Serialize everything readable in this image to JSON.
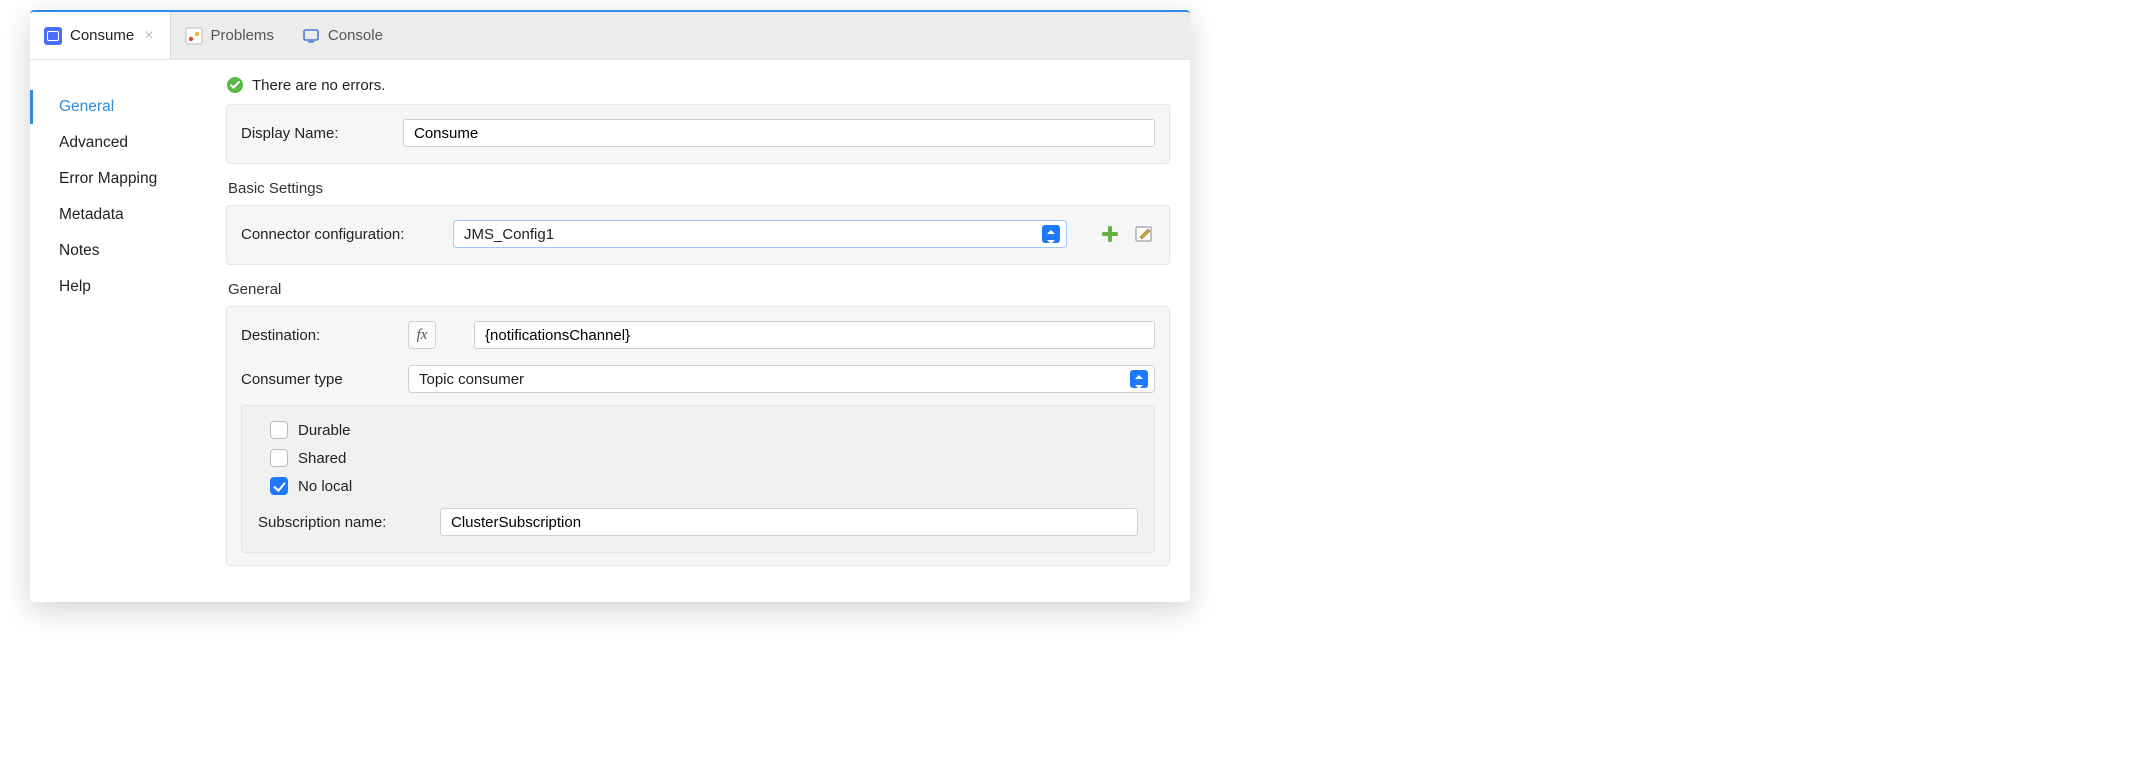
{
  "tabs": {
    "consume": {
      "label": "Consume"
    },
    "problems": {
      "label": "Problems"
    },
    "console": {
      "label": "Console"
    }
  },
  "sidebar": {
    "items": [
      {
        "label": "General"
      },
      {
        "label": "Advanced"
      },
      {
        "label": "Error Mapping"
      },
      {
        "label": "Metadata"
      },
      {
        "label": "Notes"
      },
      {
        "label": "Help"
      }
    ]
  },
  "status": {
    "message": "There are no errors."
  },
  "form": {
    "displayName": {
      "label": "Display Name:",
      "value": "Consume"
    },
    "basicSettings": {
      "title": "Basic Settings",
      "connectorConfig": {
        "label": "Connector configuration:",
        "value": "JMS_Config1"
      }
    },
    "general": {
      "title": "General",
      "destination": {
        "label": "Destination:",
        "value": "{notificationsChannel}"
      },
      "consumerType": {
        "label": "Consumer type",
        "value": "Topic consumer"
      },
      "fxLabel": "fx",
      "checkboxes": {
        "durable": {
          "label": "Durable",
          "checked": false
        },
        "shared": {
          "label": "Shared",
          "checked": false
        },
        "noLocal": {
          "label": "No local",
          "checked": true
        }
      },
      "subscriptionName": {
        "label": "Subscription name:",
        "value": "ClusterSubscription"
      }
    }
  }
}
